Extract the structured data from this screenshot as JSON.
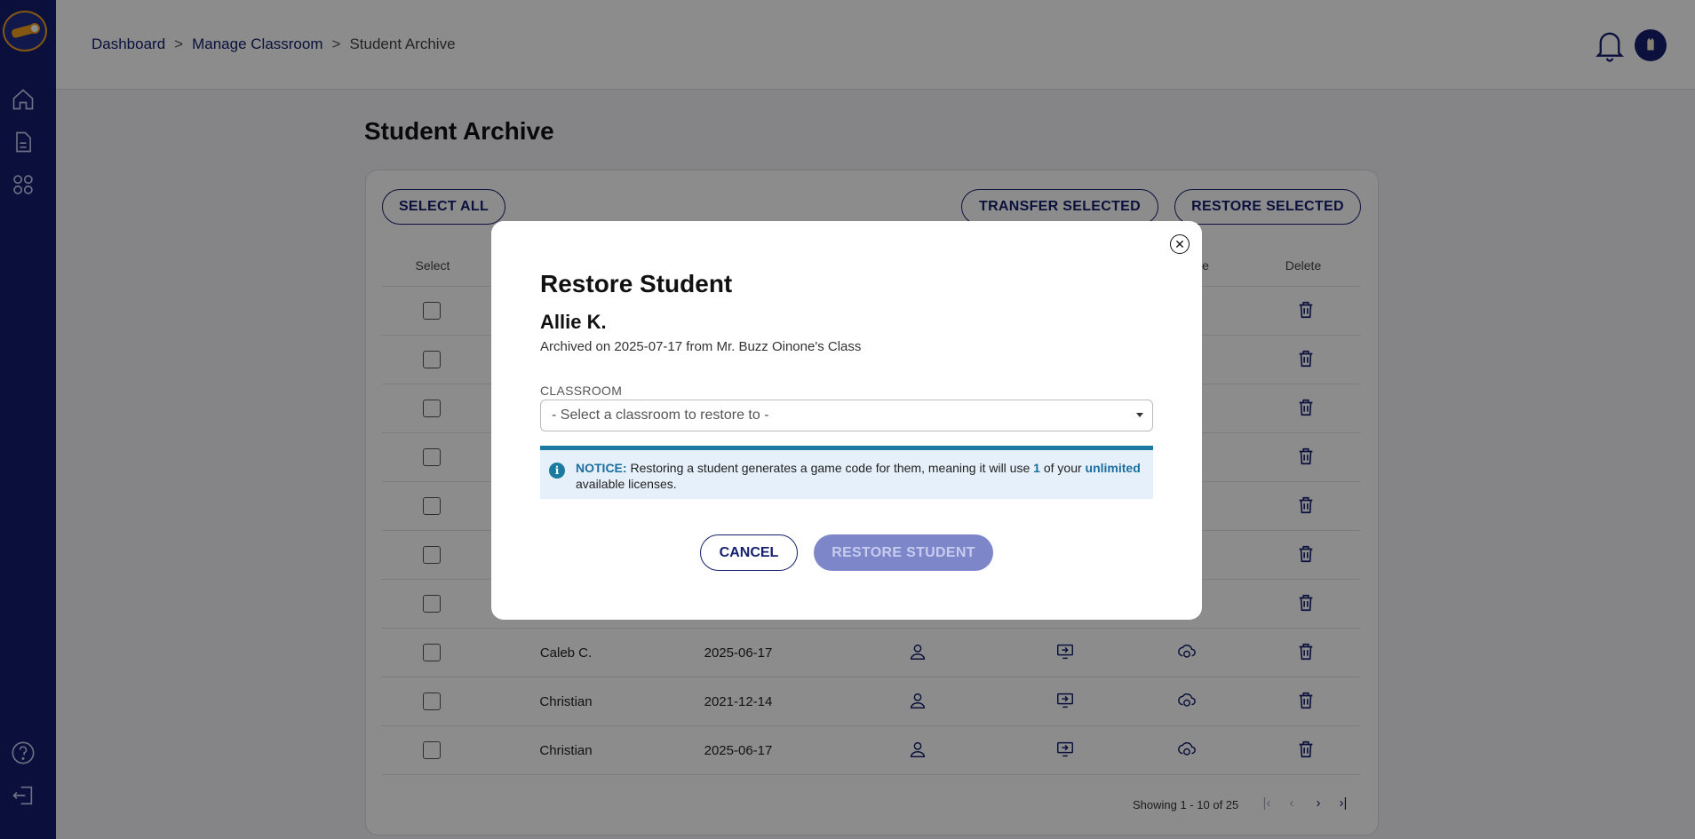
{
  "breadcrumb": {
    "items": [
      "Dashboard",
      "Manage Classroom"
    ],
    "separator": ">",
    "current": "Student Archive"
  },
  "page": {
    "title": "Student Archive"
  },
  "toolbar": {
    "select_all": "SELECT ALL",
    "transfer_selected": "TRANSFER SELECTED",
    "restore_selected": "RESTORE SELECTED"
  },
  "table": {
    "headers": {
      "select": "Select",
      "restore_partial": "e",
      "delete": "Delete"
    },
    "rows": [
      {
        "name": "Caleb C.",
        "date": "2025-06-17"
      },
      {
        "name": "Christian",
        "date": "2021-12-14"
      },
      {
        "name": "Christian",
        "date": "2025-06-17"
      }
    ]
  },
  "pagination": {
    "label": "Showing 1 - 10 of 25",
    "first": "|‹",
    "prev": "‹",
    "next": "›",
    "last": "›|"
  },
  "modal": {
    "title": "Restore Student",
    "student_name": "Allie K.",
    "archived_text": "Archived on 2025-07-17 from Mr. Buzz Oinone's Class",
    "classroom_label": "CLASSROOM",
    "classroom_placeholder": "- Select a classroom to restore to -",
    "notice": {
      "label": "NOTICE:",
      "text_before": " Restoring a student generates a game code for them, meaning it will use ",
      "count": "1",
      "text_middle": " of your ",
      "limit": "unlimited",
      "text_after": " available licenses."
    },
    "cancel": "CANCEL",
    "restore": "RESTORE STUDENT"
  },
  "colors": {
    "sidebar": "#131d6e",
    "primary": "#14206e",
    "notice": "#1b7aa0"
  },
  "icons": [
    "home-icon",
    "document-icon",
    "grid-icon",
    "help-icon",
    "logout-icon",
    "bell-icon",
    "trash-icon",
    "user-icon",
    "transfer-icon",
    "restore-icon",
    "close-icon",
    "info-icon"
  ]
}
